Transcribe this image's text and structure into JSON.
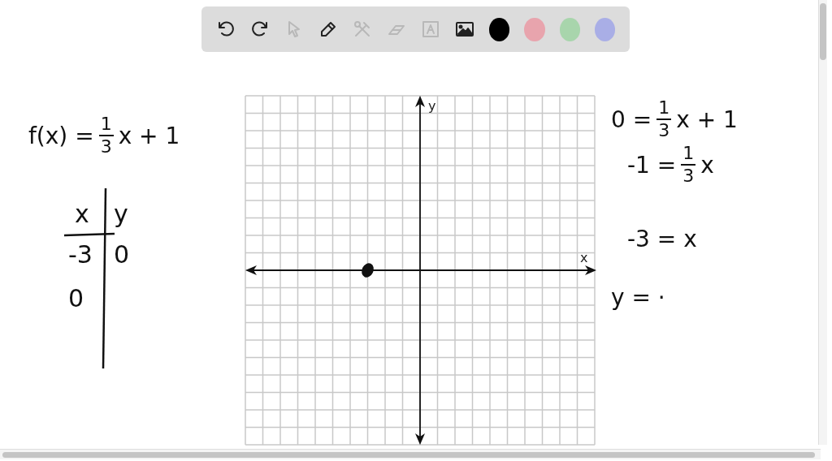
{
  "toolbar": {
    "tools": [
      {
        "kind": "undo",
        "disabled": false
      },
      {
        "kind": "redo",
        "disabled": false
      },
      {
        "kind": "pointer",
        "disabled": true
      },
      {
        "kind": "pen",
        "disabled": false
      },
      {
        "kind": "shapes",
        "disabled": true
      },
      {
        "kind": "eraser",
        "disabled": true
      },
      {
        "kind": "text",
        "disabled": true
      },
      {
        "kind": "image",
        "disabled": false
      }
    ],
    "colors": [
      {
        "color": "#000000"
      },
      {
        "color": "#e8a4ad"
      },
      {
        "color": "#a8d5ac"
      },
      {
        "color": "#a9aee6"
      }
    ]
  },
  "notes": [
    {
      "kind": "fraction-equation",
      "left": "f(x) =",
      "num": "1",
      "den": "3",
      "right": "x + 1"
    },
    {
      "kind": "fraction-equation",
      "left": "0 =",
      "num": "1",
      "den": "3",
      "right": "x + 1"
    },
    {
      "kind": "fraction-equation",
      "left": "-1 =",
      "num": "1",
      "den": "3",
      "right": "x"
    },
    {
      "kind": "equation",
      "text": "-3 = x"
    },
    {
      "kind": "equation",
      "text": "y = ·"
    }
  ],
  "table": {
    "columns": [
      "x",
      "y"
    ],
    "rows": [
      [
        "-3",
        "0"
      ],
      [
        "0",
        ""
      ]
    ]
  },
  "graph": {
    "x_label": "x",
    "y_label": "y"
  }
}
